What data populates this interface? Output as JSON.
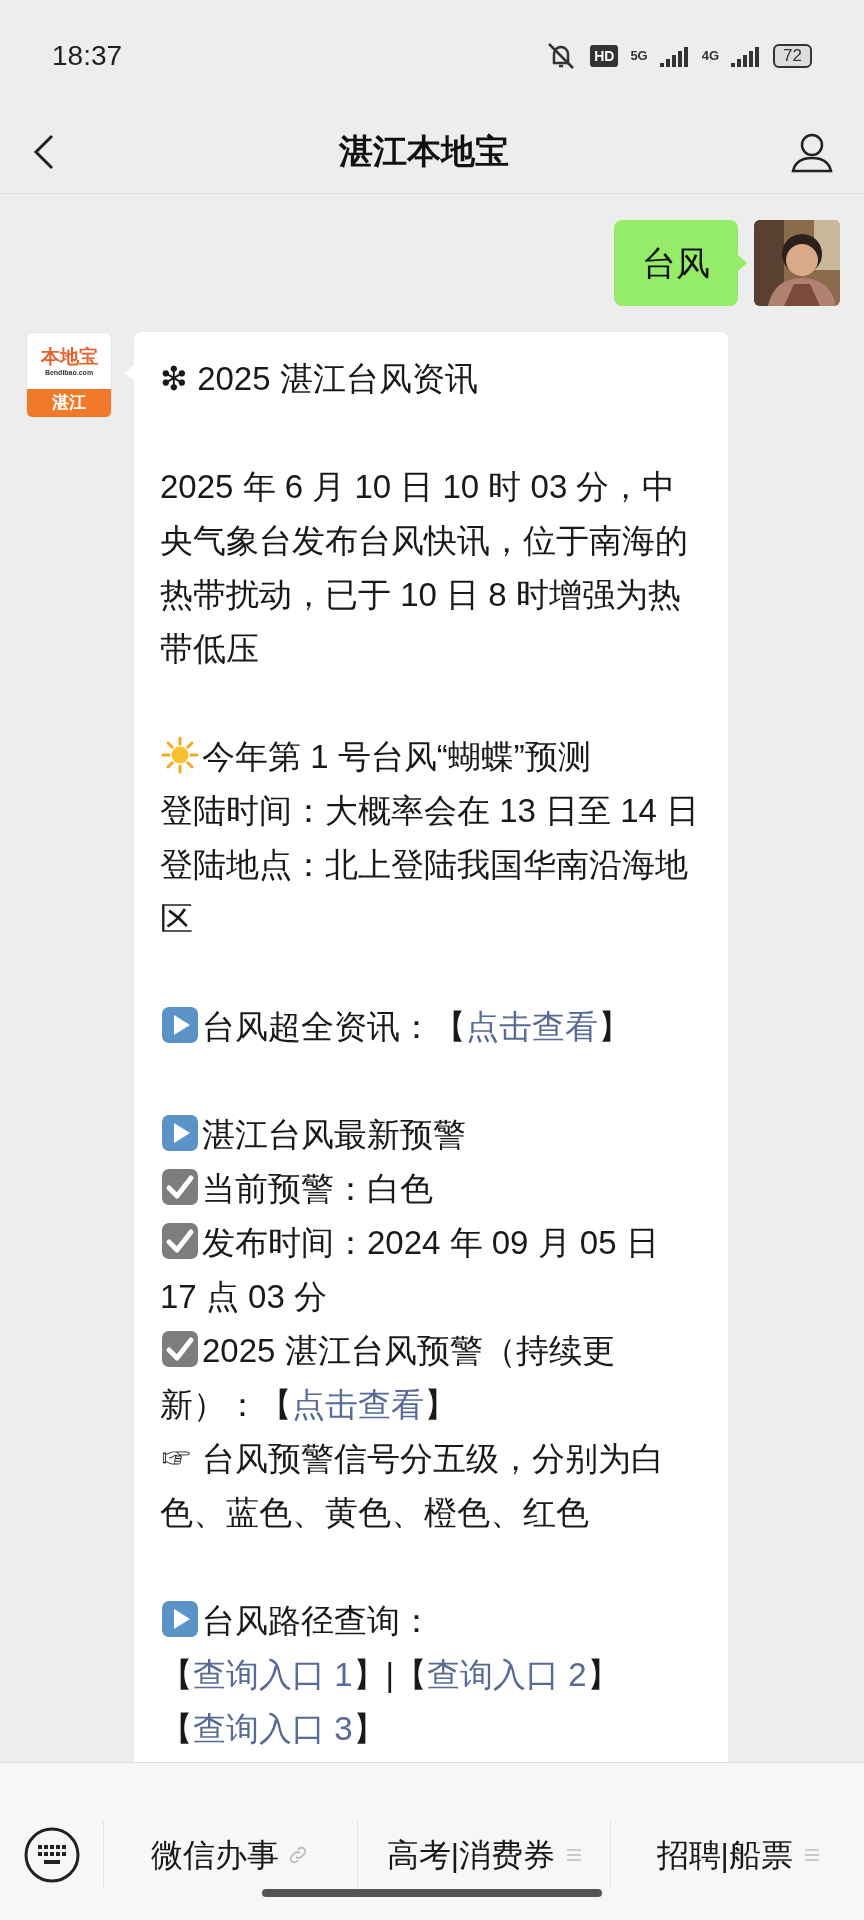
{
  "status_bar": {
    "time": "18:37",
    "hd_badge": "HD",
    "network_1": "5G",
    "network_2": "4G",
    "battery": "72"
  },
  "header": {
    "title": "湛江本地宝"
  },
  "messages": [
    {
      "kind": "sent",
      "text": "台风"
    },
    {
      "kind": "received",
      "logo": {
        "brand": "本地宝",
        "site": "Bendibao.com",
        "city": "湛江"
      },
      "blocks": [
        [
          {
            "kind": "plain",
            "parts": [
              {
                "kind": "text",
                "text": "❇ 2025 湛江台风资讯"
              }
            ]
          }
        ],
        [
          {
            "kind": "plain",
            "parts": [
              {
                "kind": "text",
                "text": "2025 年 6 月 10 日 10 时 03 分，中央气象台发布台风快讯，位于南海的热带扰动，已于 10 日 8 时增强为热带低压"
              }
            ]
          }
        ],
        [
          {
            "kind": "sun",
            "parts": [
              {
                "kind": "text",
                "text": "今年第 1 号台风“蝴蝶”预测"
              }
            ]
          },
          {
            "kind": "plain",
            "parts": [
              {
                "kind": "text",
                "text": "登陆时间：大概率会在 13 日至 14 日"
              }
            ]
          },
          {
            "kind": "plain",
            "parts": [
              {
                "kind": "text",
                "text": "登陆地点：北上登陆我国华南沿海地区"
              }
            ]
          }
        ],
        [
          {
            "kind": "play",
            "parts": [
              {
                "kind": "text",
                "text": "台风超全资讯：【"
              },
              {
                "kind": "link",
                "text": "点击查看"
              },
              {
                "kind": "text",
                "text": "】"
              }
            ]
          }
        ],
        [
          {
            "kind": "play",
            "parts": [
              {
                "kind": "text",
                "text": "湛江台风最新预警"
              }
            ]
          },
          {
            "kind": "check",
            "parts": [
              {
                "kind": "text",
                "text": "当前预警：白色"
              }
            ]
          },
          {
            "kind": "check",
            "parts": [
              {
                "kind": "text",
                "text": "发布时间：2024 年 09 月 05 日 17 点 03 分"
              }
            ]
          },
          {
            "kind": "check",
            "parts": [
              {
                "kind": "text",
                "text": "2025 湛江台风预警（持续更新）：【"
              },
              {
                "kind": "link",
                "text": "点击查看"
              },
              {
                "kind": "text",
                "text": "】"
              }
            ]
          },
          {
            "kind": "plain",
            "parts": [
              {
                "kind": "text",
                "text": "☞ 台风预警信号分五级，分别为白色、蓝色、黄色、橙色、红色"
              }
            ]
          }
        ],
        [
          {
            "kind": "play",
            "parts": [
              {
                "kind": "text",
                "text": "台风路径查询："
              }
            ]
          },
          {
            "kind": "plain",
            "parts": [
              {
                "kind": "text",
                "text": "【"
              },
              {
                "kind": "link",
                "text": "查询入口 1"
              },
              {
                "kind": "text",
                "text": "】|【"
              },
              {
                "kind": "link",
                "text": "查询入口 2"
              },
              {
                "kind": "text",
                "text": "】"
              }
            ]
          },
          {
            "kind": "plain",
            "parts": [
              {
                "kind": "text",
                "text": "【"
              },
              {
                "kind": "link",
                "text": "查询入口 3"
              },
              {
                "kind": "text",
                "text": "】"
              }
            ]
          }
        ]
      ]
    }
  ],
  "bottom_menu": [
    {
      "label": "微信办事",
      "kind": "link"
    },
    {
      "label": "高考|消费券",
      "kind": "list"
    },
    {
      "label": "招聘|船票",
      "kind": "list"
    }
  ]
}
